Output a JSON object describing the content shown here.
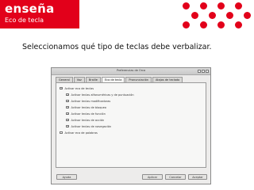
{
  "header": {
    "brand": "enseña",
    "subtitle": "Eco de tecla"
  },
  "heading": "Seleccionamos qué tipo de teclas debe verbalizar.",
  "dialog": {
    "title": "Preferencias de Orca",
    "tabs": [
      {
        "label": "General"
      },
      {
        "label": "Voz"
      },
      {
        "label": "Braille"
      },
      {
        "label": "Eco de tecla",
        "active": true
      },
      {
        "label": "Pronunciación"
      },
      {
        "label": "Atajos de teclado"
      }
    ],
    "options": [
      {
        "label": "Activar eco de teclas",
        "checked": true
      },
      {
        "label": "Activar teclas alfanuméricas y de puntuación",
        "checked": true
      },
      {
        "label": "Activar teclas modificadoras",
        "checked": true
      },
      {
        "label": "Activar teclas de bloqueo",
        "checked": true
      },
      {
        "label": "Activar teclas de función",
        "checked": true
      },
      {
        "label": "Activar teclas de acción",
        "checked": true
      },
      {
        "label": "Activar teclas de navegación",
        "checked": true
      },
      {
        "label": "Activar eco de palabras",
        "checked": false
      }
    ],
    "buttons": {
      "help": "Ayuda",
      "apply": "Aplicar",
      "cancel": "Cancelar",
      "accept": "Aceptar"
    }
  },
  "colors": {
    "brand_red": "#e2001a"
  }
}
